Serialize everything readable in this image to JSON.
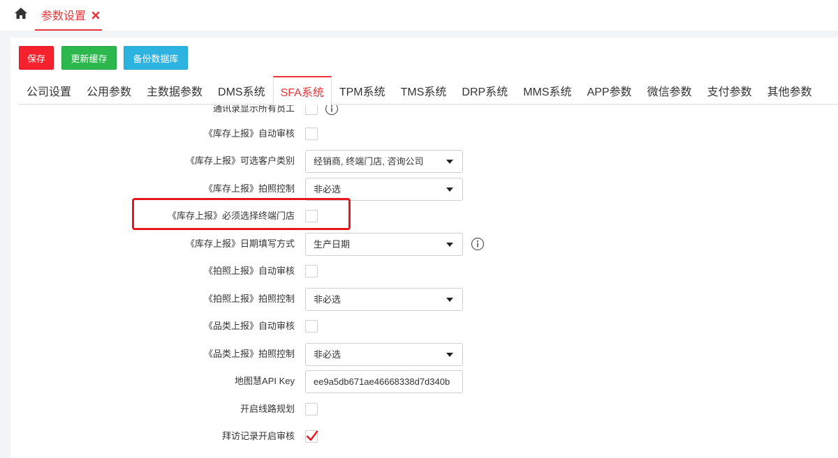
{
  "topbar": {
    "home_icon": "home-icon",
    "page_tab_label": "参数设置",
    "close_icon": "close-icon",
    "accent_color": "#e8343a"
  },
  "toolbar": {
    "save_label": "保存",
    "refresh_cache_label": "更新缓存",
    "backup_db_label": "备份数据库"
  },
  "tabs": [
    {
      "label": "公司设置"
    },
    {
      "label": "公用参数"
    },
    {
      "label": "主数据参数"
    },
    {
      "label": "DMS系统"
    },
    {
      "label": "SFA系统",
      "active": true
    },
    {
      "label": "TPM系统"
    },
    {
      "label": "TMS系统"
    },
    {
      "label": "DRP系统"
    },
    {
      "label": "MMS系统"
    },
    {
      "label": "APP参数"
    },
    {
      "label": "微信参数"
    },
    {
      "label": "支付参数"
    },
    {
      "label": "其他参数"
    }
  ],
  "form": {
    "row0": {
      "label": "通讯录显示所有员工",
      "checked": false
    },
    "row1": {
      "label": "《库存上报》自动审核",
      "checked": false
    },
    "row2": {
      "label": "《库存上报》可选客户类别",
      "value": "经销商, 终端门店, 咨询公司"
    },
    "row3": {
      "label": "《库存上报》拍照控制",
      "value": "非必选"
    },
    "row4": {
      "label": "《库存上报》必须选择终端门店",
      "checked": false
    },
    "row5": {
      "label": "《库存上报》日期填写方式",
      "value": "生产日期"
    },
    "row6": {
      "label": "《拍照上报》自动审核",
      "checked": false
    },
    "row7": {
      "label": "《拍照上报》拍照控制",
      "value": "非必选"
    },
    "row8": {
      "label": "《品类上报》自动审核",
      "checked": false
    },
    "row9": {
      "label": "《品类上报》拍照控制",
      "value": "非必选"
    },
    "row10": {
      "label": "地图慧API Key",
      "value": "ee9a5db671ae46668338d7d340b"
    },
    "row11": {
      "label": "开启线路规划",
      "checked": false
    },
    "row12": {
      "label": "拜访记录开启审核",
      "checked": true
    }
  },
  "colors": {
    "save": "#f5222d",
    "refresh_cache": "#2db84d",
    "backup": "#2cb3e0",
    "highlight": "#e8161d"
  }
}
